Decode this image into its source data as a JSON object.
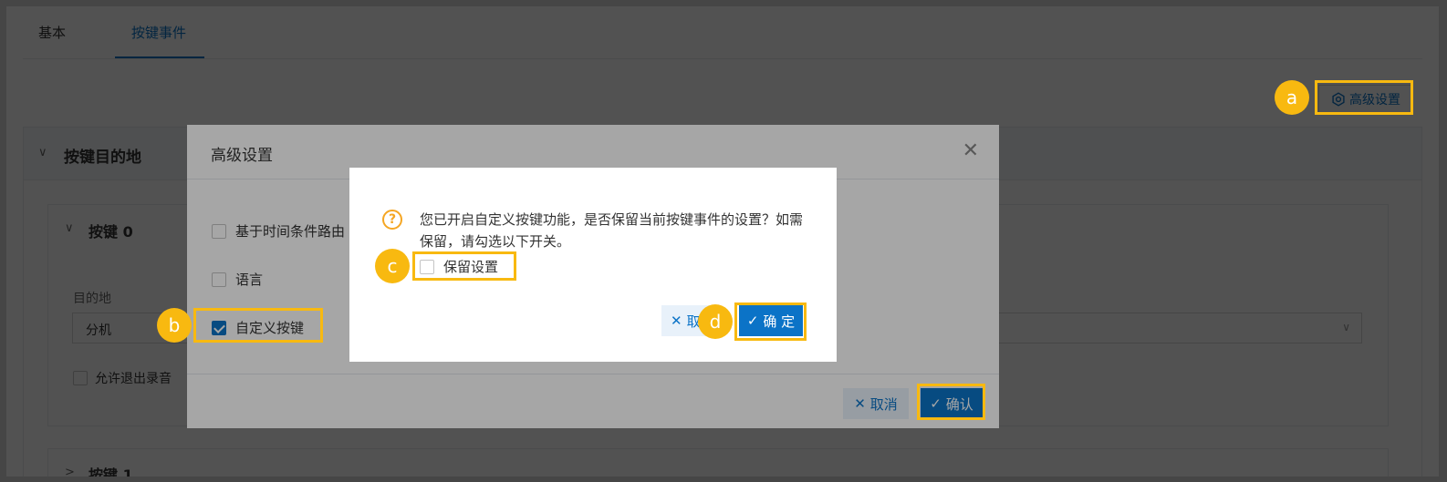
{
  "tabs": [
    {
      "label": "基本"
    },
    {
      "label": "按键事件"
    }
  ],
  "advanced_button": {
    "label": "高级设置",
    "icon": "gear-icon"
  },
  "section": {
    "title": "按键目的地",
    "key0": {
      "title": "按键 0",
      "destination_label": "目的地",
      "destination_value": "分机",
      "allow_exit_label": "允许退出录音"
    },
    "key1": {
      "title": "按键 1"
    }
  },
  "dialog": {
    "title": "高级设置",
    "options": [
      {
        "label": "基于时间条件路由",
        "checked": false
      },
      {
        "label": "语言",
        "checked": false
      },
      {
        "label": "自定义按键",
        "checked": true
      }
    ],
    "cancel_label": "取消",
    "ok_label": "确认"
  },
  "confirm": {
    "message": "您已开启自定义按键功能，是否保留当前按键事件的设置？如需保留，请勾选以下开关。",
    "keep_label": "保留设置",
    "cancel_label": "取",
    "ok_label": "确 定"
  },
  "annotations": {
    "a": "a",
    "b": "b",
    "c": "c",
    "d": "d"
  },
  "colors": {
    "primary": "#0b73c7",
    "highlight": "#f8b910",
    "warning": "#f5a623"
  }
}
